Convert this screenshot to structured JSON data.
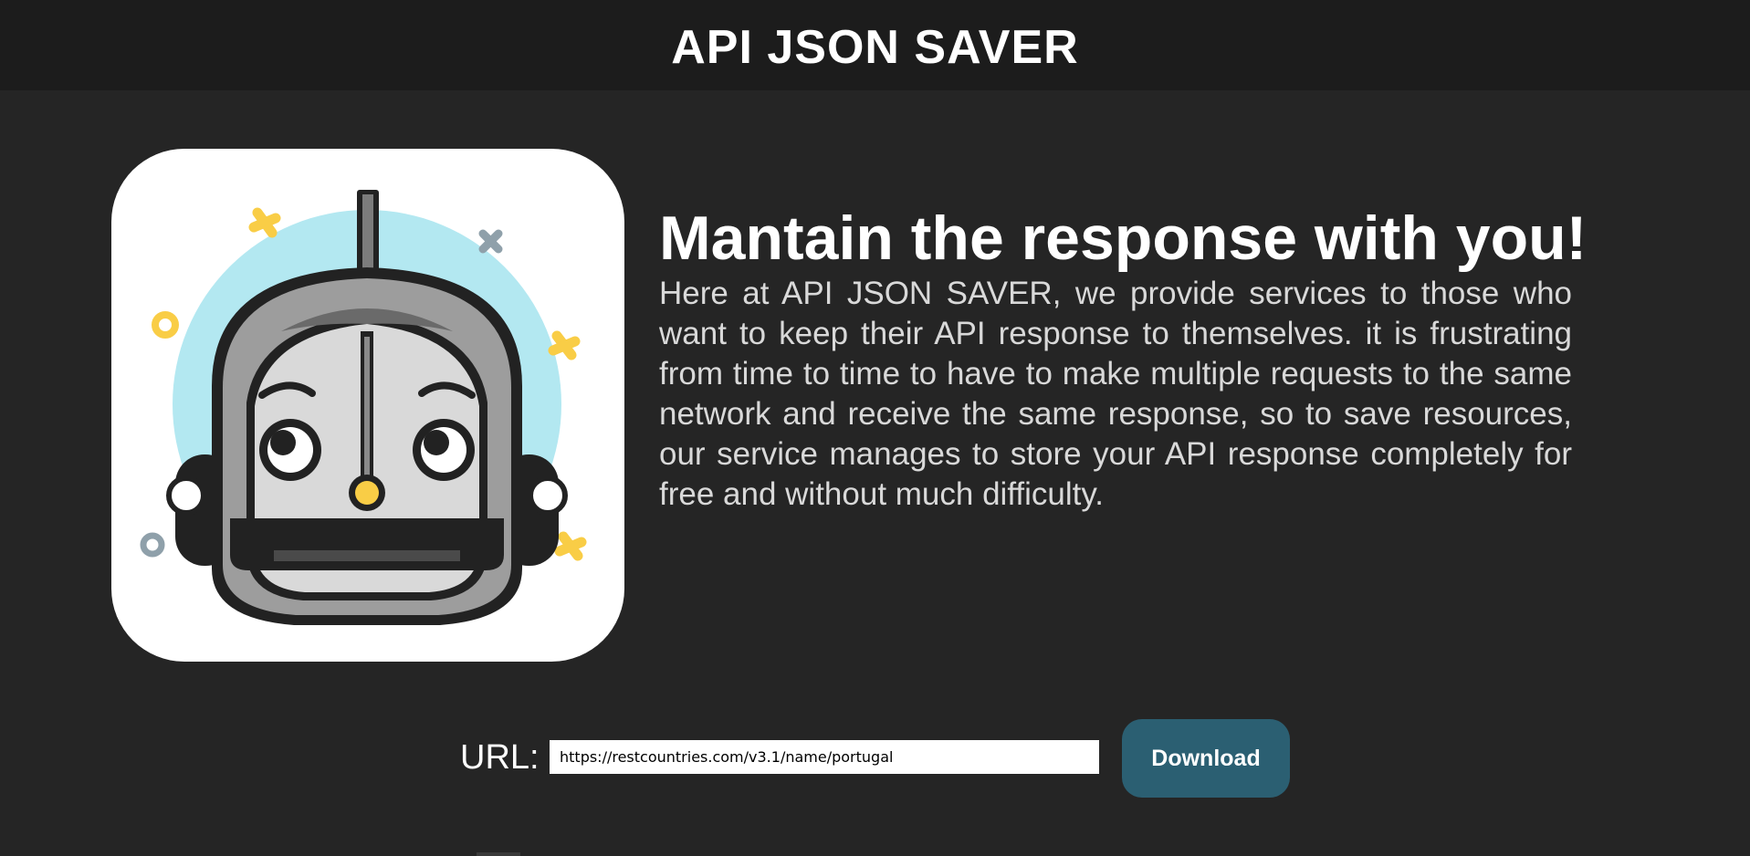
{
  "header": {
    "title": "API JSON SAVER"
  },
  "hero": {
    "logo_icon": "robot-head-icon",
    "headline": "Mantain the response with you!",
    "description": "Here at API JSON SAVER, we provide services to those who want to keep their API response to themselves. it is frustrating from time to time to have to make multiple requests to the same network and receive the same response, so to save resources, our service manages to store your API response completely for free and without much difficulty."
  },
  "form": {
    "url_label": "URL:",
    "url_value": "https://restcountries.com/v3.1/name/portugal",
    "download_label": "Download"
  },
  "colors": {
    "background": "#252525",
    "header_background": "#1c1c1c",
    "button_background": "#2b5f72",
    "logo_sky": "#b3e8f1",
    "logo_accent_yellow": "#f9cd46"
  }
}
